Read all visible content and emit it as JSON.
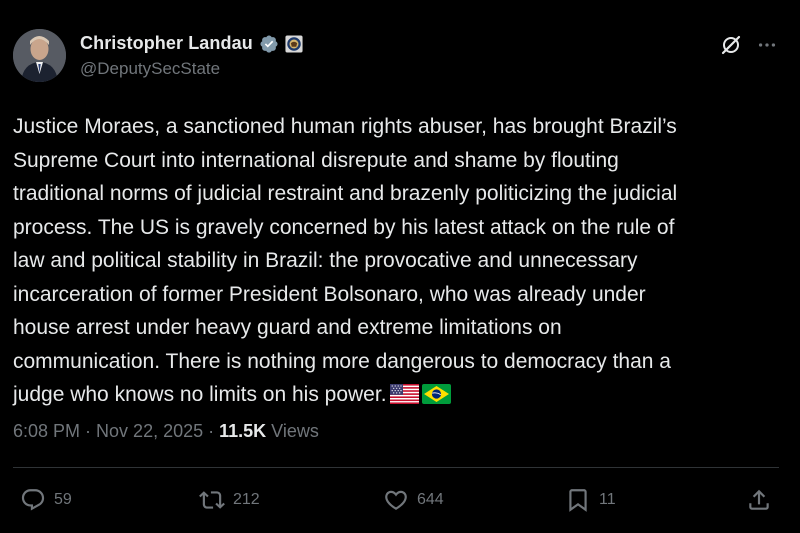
{
  "author": {
    "name": "Christopher Landau",
    "handle": "@DeputySecState",
    "verified_icon": "verified-badge-icon",
    "affiliation_icon": "state-department-seal-icon"
  },
  "tweet": {
    "text": "Justice Moraes, a sanctioned human rights abuser, has brought Brazil’s\nSupreme Court into international disrepute and shame by flouting\ntraditional norms of judicial restraint and brazenly politicizing the judicial\nprocess. The US is gravely concerned by his latest attack on the rule of\nlaw and political stability in Brazil: the provocative and unnecessary\nincarceration of former President Bolsonaro, who was already under\nhouse arrest under heavy guard and extreme limitations on\ncommunication. There is nothing more dangerous to democracy than a\njudge who knows no limits on his power.",
    "flags": [
      "us-flag",
      "brazil-flag"
    ]
  },
  "meta": {
    "time": "6:08 PM",
    "sep1": " · ",
    "date": "Nov 22, 2025",
    "sep2": " · ",
    "views_count": "11.5K",
    "views_label": " Views"
  },
  "actions": {
    "replies": "59",
    "reposts": "212",
    "likes": "644",
    "bookmarks": "11"
  },
  "colors": {
    "background": "#000000",
    "text": "#e7e9ea",
    "muted": "#71767b",
    "verified": "#829aab",
    "divider": "#2f3336"
  }
}
